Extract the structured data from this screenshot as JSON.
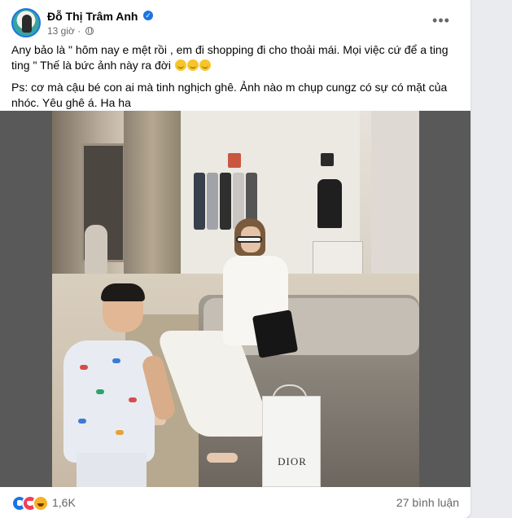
{
  "post": {
    "author": "Đỗ Thị Trâm Anh",
    "time": "13 giờ",
    "separator": "·",
    "more_label": "•••",
    "verified_glyph": "✓",
    "text_line1": "Any bảo là \" hôm nay e mệt rồi , em đi shopping đi cho thoải mái. Mọi việc cứ để a ting ting \" Thế là bức ảnh này ra đời",
    "text_line2": "Ps: cơ mà cậu bé con ai mà tinh nghịch ghê. Ảnh nào m chụp cungz có sự có mặt của nhóc. Yêu ghê á. Ha ha",
    "photo_bag_text": "DIOR"
  },
  "footer": {
    "reaction_count": "1,6K",
    "comments": "27 bình luận"
  },
  "icons": [
    "verified-icon",
    "globe-icon",
    "more-icon",
    "like-icon",
    "love-icon",
    "haha-icon"
  ],
  "colors": {
    "accent": "#1b74e4",
    "text": "#050505",
    "secondary_text": "#65676b",
    "background": "#e9ebee"
  }
}
